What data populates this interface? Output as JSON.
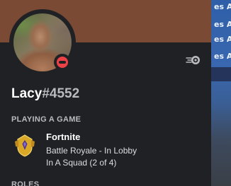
{
  "background_app": {
    "lines": [
      "es Alive",
      "es Alive",
      "es Ali",
      "es Ali"
    ]
  },
  "profile": {
    "username": "Lacy",
    "discriminator": "#4552",
    "status": "do-not-disturb",
    "avatar_icon": "user-avatar",
    "badge_icon": "nitro-badge-icon",
    "banner_color": "#7b4a35"
  },
  "activity": {
    "section_title": "PLAYING A GAME",
    "game_name": "Fortnite",
    "details": "Battle Royale - In Lobby",
    "state": "In A Squad (2 of 4)",
    "icon": "fortnite-icon"
  },
  "roles": {
    "section_title": "ROLES"
  },
  "colors": {
    "dnd": "#ed4245",
    "popout_bg": "#1f2125"
  }
}
